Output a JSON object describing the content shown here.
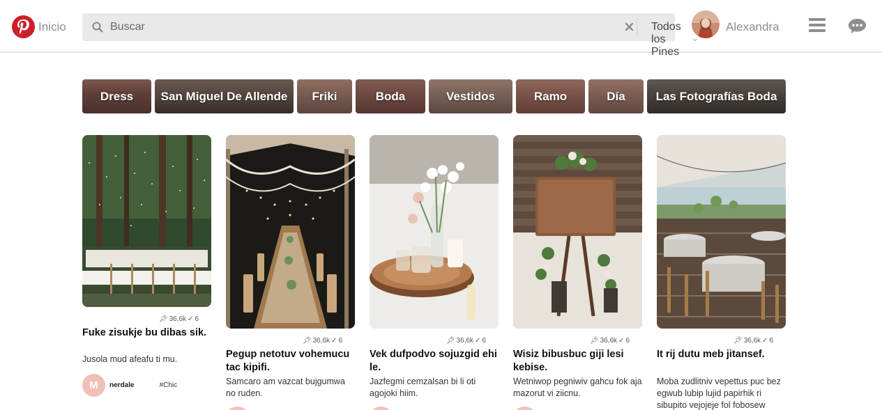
{
  "header": {
    "home_label": "Inicio",
    "search_placeholder": "Buscar",
    "scope_label": "Todos los Pines",
    "user_name": "Alexandra"
  },
  "chips": [
    {
      "label": "Dress"
    },
    {
      "label": "San Miguel De Allende"
    },
    {
      "label": "Friki"
    },
    {
      "label": "Boda"
    },
    {
      "label": "Vestidos"
    },
    {
      "label": "Ramo"
    },
    {
      "label": "Día"
    },
    {
      "label": "Las Fotografías Boda"
    }
  ],
  "pins": [
    {
      "saves": "36,6k",
      "likes": "6",
      "title": "Fuke zisukje bu dibas sik.",
      "description": "Jusola mud afeafu ti mu.",
      "author_initial": "M",
      "author": "nerdale",
      "tag": "#Chic"
    },
    {
      "saves": "36,6k",
      "likes": "6",
      "title": "Pegup netotuv vohemucu tac kipifi.",
      "description": "Samcaro am vazcat bujgumwa no ruden."
    },
    {
      "saves": "36,6k",
      "likes": "6",
      "title": "Vek dufpodvo sojuzgid ehi le.",
      "description": "Jazfegmi cemzalsan bi li oti agojoki hiim."
    },
    {
      "saves": "36,6k",
      "likes": "6",
      "title": "Wisiz bibusbuc giji lesi kebise.",
      "description": "Wetniwop pegniwiv gahcu fok aja mazorut vi ziicnu."
    },
    {
      "saves": "36,6k",
      "likes": "6",
      "title": "It rij dutu meb jitansef.",
      "description": "Moba zudlitniv vepettus puc bez egwub lubip lujid papirhik ri sibupito vejojeje fol fobosew"
    }
  ]
}
